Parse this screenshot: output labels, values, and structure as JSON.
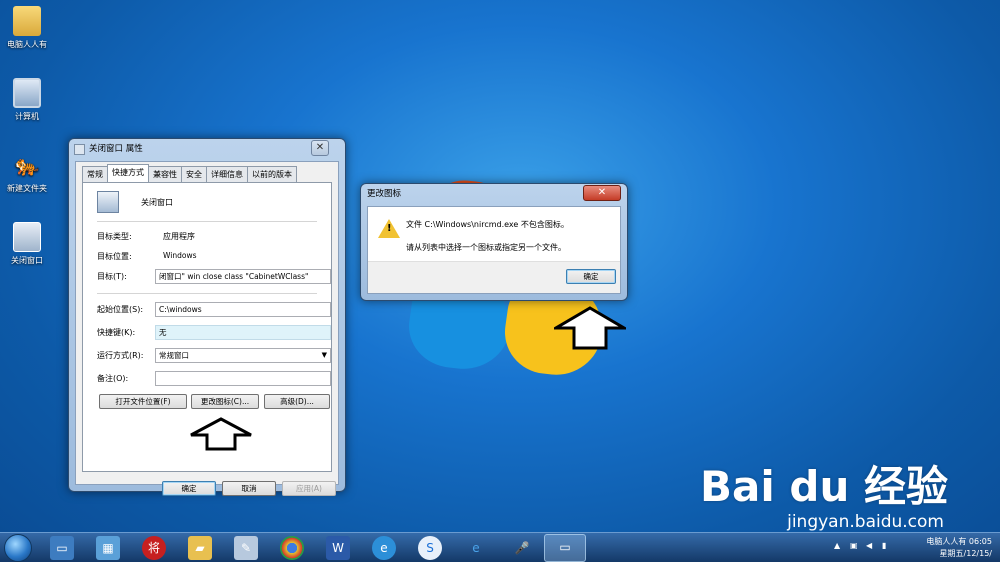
{
  "desktop_icons": [
    {
      "label": "电脑人人有",
      "icon": "folder-icon"
    },
    {
      "label": "计算机",
      "icon": "computer-icon"
    },
    {
      "label": "新建文件夹",
      "icon": "tiger-icon"
    },
    {
      "label": "关闭窗口",
      "icon": "shortcut-icon"
    }
  ],
  "properties": {
    "title": "关闭窗口 属性",
    "tabs": [
      "常规",
      "快捷方式",
      "兼容性",
      "安全",
      "详细信息",
      "以前的版本"
    ],
    "active_tab": "快捷方式",
    "name": "关闭窗口",
    "target_type_label": "目标类型:",
    "target_type": "应用程序",
    "target_location_label": "目标位置:",
    "target_location": "Windows",
    "target_label": "目标(T):",
    "target": "闭窗口\" win close class \"CabinetWClass\"",
    "start_in_label": "起始位置(S):",
    "start_in": "C:\\windows",
    "hotkey_label": "快捷键(K):",
    "hotkey": "无",
    "run_label": "运行方式(R):",
    "run": "常规窗口",
    "comment_label": "备注(O):",
    "comment": "",
    "btn_open_location": "打开文件位置(F)",
    "btn_change_icon": "更改图标(C)...",
    "btn_advanced": "高级(D)...",
    "btn_ok": "确定",
    "btn_cancel": "取消",
    "btn_apply": "应用(A)"
  },
  "change_icon": {
    "title": "更改图标",
    "message1": "文件 C:\\Windows\\nircmd.exe 不包含图标。",
    "message2": "请从列表中选择一个图标或指定另一个文件。",
    "btn_ok": "确定"
  },
  "taskbar": {
    "items": [
      "desktop-icon",
      "control-panel-icon",
      "chess-icon",
      "folder-icon",
      "paint-icon",
      "chrome-icon",
      "word-icon",
      "edge-icon",
      "sogou-icon",
      "ie-icon",
      "microphone-icon",
      "window-icon"
    ],
    "tray_user": "电脑人人有 06:05",
    "tray_date": "星期五/12/15/"
  },
  "watermark": {
    "brand": "Bai du 经验",
    "url": "jingyan.baidu.com"
  },
  "colors": {
    "desktop": "#1874cf",
    "close": "#c43c27",
    "warning": "#f1c232"
  }
}
